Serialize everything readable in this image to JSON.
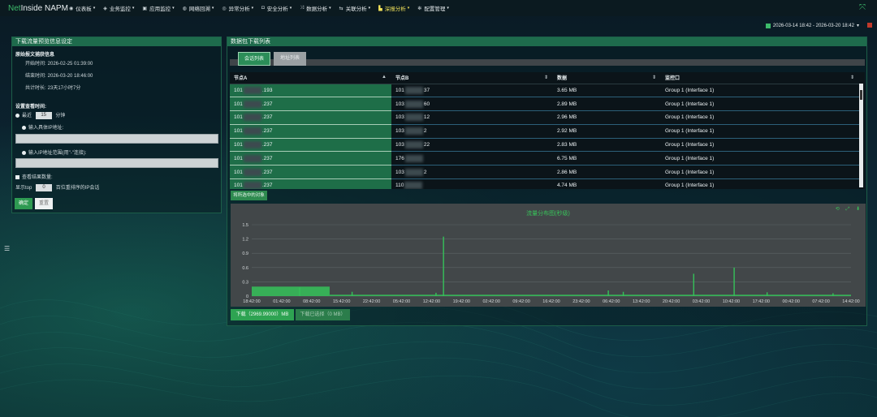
{
  "app": {
    "brand_net": "Net",
    "brand_rest": "Inside NAPM"
  },
  "nav": [
    {
      "icon": "dashboard-icon",
      "glyph": "◉",
      "label": "仪表板"
    },
    {
      "icon": "business-icon",
      "glyph": "◈",
      "label": "业务监控"
    },
    {
      "icon": "app-monitor-icon",
      "glyph": "▣",
      "label": "应用监控"
    },
    {
      "icon": "network-icon",
      "glyph": "◍",
      "label": "网络回溯"
    },
    {
      "icon": "eye-icon",
      "glyph": "◎",
      "label": "异常分析"
    },
    {
      "icon": "shield-icon",
      "glyph": "◘",
      "label": "安全分析"
    },
    {
      "icon": "shuffle-icon",
      "glyph": "⤨",
      "label": "数据分析"
    },
    {
      "icon": "link-icon",
      "glyph": "⇆",
      "label": "关联分析"
    },
    {
      "icon": "bar-chart-icon",
      "glyph": "▙",
      "label": "深报分析",
      "active": true
    },
    {
      "icon": "gear-icon",
      "glyph": "✻",
      "label": "配置管理"
    }
  ],
  "daterange": "2026-03-14 18:42 - 2026-03-20 18:42",
  "left_panel": {
    "title": "下载流量预览信息设定",
    "section1": "原始报文捕获信息",
    "start_label": "开始时间:",
    "start_value": "2026-02-25 01:39:00",
    "end_label": "结束时间:",
    "end_value": "2026-03-20 18:46:00",
    "total_label": "共计时长:",
    "total_value": "23天17小时7分",
    "section2": "设置查看时间:",
    "recent_label": "最近",
    "recent_value": "15",
    "recent_unit": "分钟",
    "ip_label": "输入具体IP地址:",
    "range_label": "输入IP地址范围(用\"-\"连接):",
    "view_results_label": "查看结果数量:",
    "show_top_label": "显示top",
    "show_top_value": "0",
    "show_top_suffix": "百位重排序的IP会话",
    "ok_label": "确定",
    "reset_label": "重置"
  },
  "right_panel": {
    "title": "数据包下载列表",
    "tab_session": "会话列表",
    "tab_address": "地址列表",
    "columns": [
      "节点A",
      "节点B",
      "数据",
      "监控口"
    ],
    "rows": [
      {
        "a_pre": "101",
        "a_suf": ".193",
        "b_pre": "101",
        "b_suf": "37",
        "data": "3.65 MB",
        "iface": "Group 1 (Interface 1)"
      },
      {
        "a_pre": "101",
        "a_suf": ".237",
        "b_pre": "103",
        "b_suf": "60",
        "data": "2.89 MB",
        "iface": "Group 1 (Interface 1)"
      },
      {
        "a_pre": "101",
        "a_suf": ".237",
        "b_pre": "103",
        "b_suf": "12",
        "data": "2.96 MB",
        "iface": "Group 1 (Interface 1)"
      },
      {
        "a_pre": "101",
        "a_suf": ".237",
        "b_pre": "103",
        "b_suf": "2",
        "data": "2.92 MB",
        "iface": "Group 1 (Interface 1)"
      },
      {
        "a_pre": "101",
        "a_suf": ".237",
        "b_pre": "103",
        "b_suf": "22",
        "data": "2.83 MB",
        "iface": "Group 1 (Interface 1)"
      },
      {
        "a_pre": "101",
        "a_suf": ".237",
        "b_pre": "176",
        "b_suf": "",
        "data": "6.75 MB",
        "iface": "Group 1 (Interface 1)"
      },
      {
        "a_pre": "101",
        "a_suf": ".237",
        "b_pre": "103",
        "b_suf": "2",
        "data": "2.86 MB",
        "iface": "Group 1 (Interface 1)"
      },
      {
        "a_pre": "101",
        "a_suf": ".237",
        "b_pre": "110",
        "b_suf": "",
        "data": "4.74 MB",
        "iface": "Group 1 (Interface 1)"
      }
    ],
    "download_selected": "将所选中的对象",
    "download_label": "下载（2969.99000）MB",
    "download_filtered_label": "下载已选择（0 MB）"
  },
  "chart_data": {
    "type": "area",
    "title": "流量分布图(秒级)",
    "ylim": [
      0,
      1.5
    ],
    "yticks": [
      "1.5",
      "1.2",
      "0.9",
      "0.6",
      "0.3",
      "0"
    ],
    "xticks": [
      "18:42:00",
      "01:42:00",
      "08:42:00",
      "15:42:00",
      "22:42:00",
      "05:42:00",
      "12:42:00",
      "19:42:00",
      "02:42:00",
      "09:42:00",
      "16:42:00",
      "23:42:00",
      "06:42:00",
      "13:42:00",
      "20:42:00",
      "03:42:00",
      "10:42:00",
      "17:42:00",
      "00:42:00",
      "07:42:00",
      "14:42:00"
    ],
    "color": "#35c259",
    "baseline_blocks": [
      {
        "from": 0.0,
        "to": 2.6,
        "level": 0.2
      },
      {
        "from": 2.6,
        "to": 20.0,
        "level": 0.03
      }
    ],
    "spikes": [
      {
        "x": 1.6,
        "y": 0.18
      },
      {
        "x": 3.35,
        "y": 0.09
      },
      {
        "x": 6.15,
        "y": 0.07
      },
      {
        "x": 6.4,
        "y": 1.25
      },
      {
        "x": 11.9,
        "y": 0.12
      },
      {
        "x": 12.4,
        "y": 0.09
      },
      {
        "x": 14.75,
        "y": 0.47
      },
      {
        "x": 16.1,
        "y": 0.6
      },
      {
        "x": 17.2,
        "y": 0.08
      },
      {
        "x": 19.4,
        "y": 0.06
      }
    ]
  }
}
